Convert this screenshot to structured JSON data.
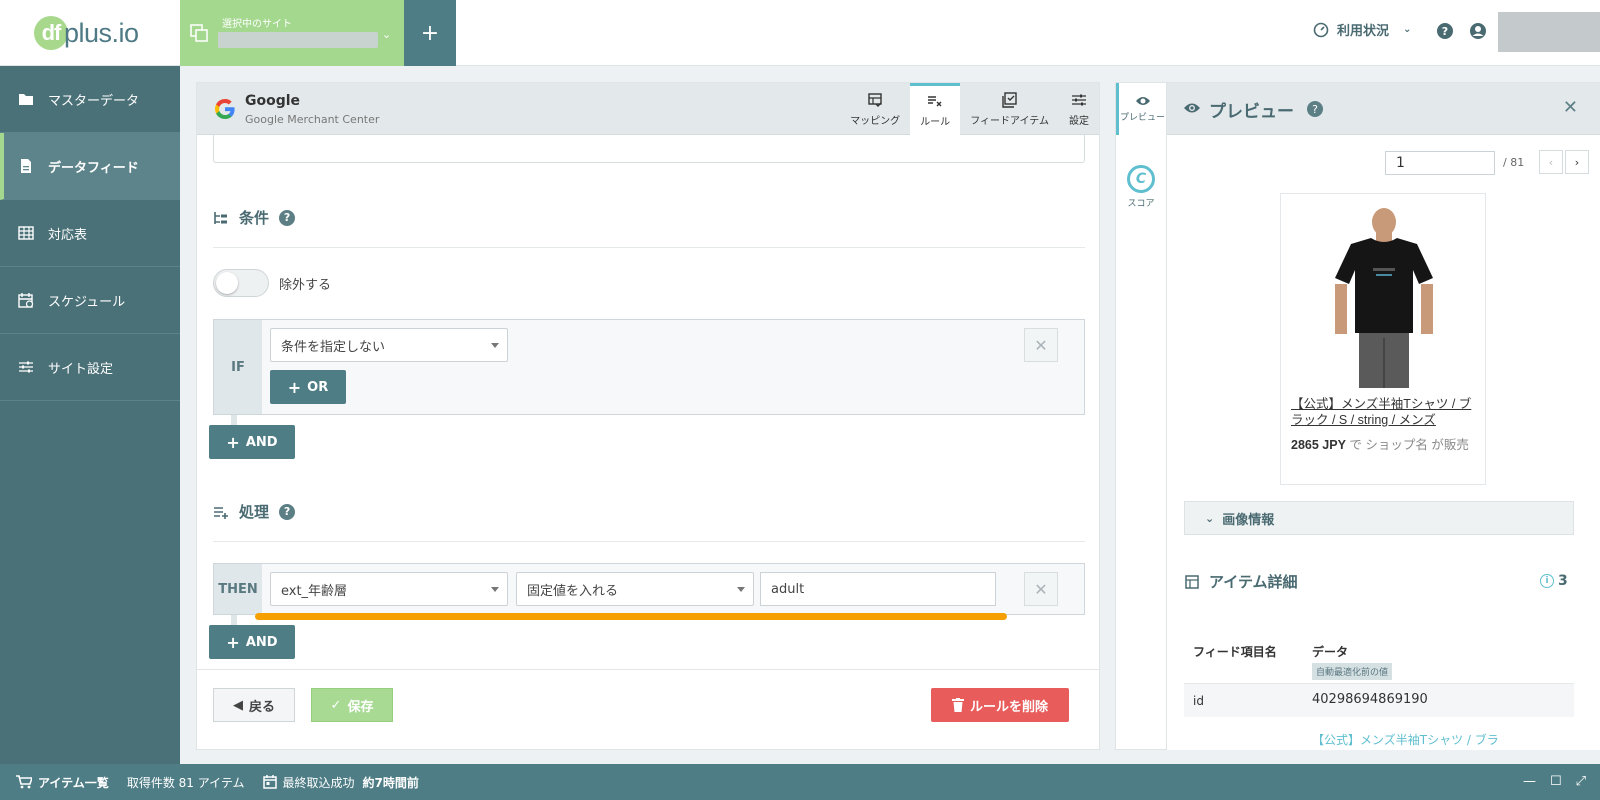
{
  "topbar": {
    "logo_text": "plus.io",
    "logo_mark": "df",
    "site_label": "選択中のサイト",
    "add_site": "+",
    "usage": "利用状況"
  },
  "sidebar": {
    "items": [
      {
        "label": "マスターデータ",
        "icon": "folder-icon"
      },
      {
        "label": "データフィード",
        "icon": "document-icon"
      },
      {
        "label": "対応表",
        "icon": "table-icon"
      },
      {
        "label": "スケジュール",
        "icon": "calendar-icon"
      },
      {
        "label": "サイト設定",
        "icon": "sliders-icon"
      }
    ]
  },
  "panel": {
    "channel_name": "Google",
    "channel_sub": "Google Merchant Center",
    "tabs": [
      {
        "label": "マッピング"
      },
      {
        "label": "ルール"
      },
      {
        "label": "フィードアイテム"
      },
      {
        "label": "設定"
      }
    ],
    "conditions_title": "条件",
    "exclude_label": "除外する",
    "if_label": "IF",
    "condition_select": "条件を指定しない",
    "or_button": "OR",
    "and_button": "AND",
    "process_title": "処理",
    "then_label": "THEN",
    "field_select": "ext_年齢層",
    "action_select": "固定値を入れる",
    "value_input": "adult",
    "back_button": "戻る",
    "save_button": "保存",
    "delete_button": "ルールを削除"
  },
  "rail": {
    "preview": "プレビュー",
    "score": "スコア",
    "score_letter": "C"
  },
  "preview": {
    "title": "プレビュー",
    "page_value": "1",
    "page_total": "/ 81",
    "product_title": "【公式】メンズ半袖Tシャツ / ブラック / S / string / メンズ",
    "price": "2865 JPY",
    "price_suffix": " で ショップ名 が販売",
    "image_info": "画像情報",
    "details_title": "アイテム詳細",
    "details_count": "3",
    "col_field": "フィード項目名",
    "col_data": "データ",
    "col_badge": "自動最適化前の値",
    "row_key": "id",
    "row_value": "40298694869190",
    "row2_value": "【公式】メンズ半袖Tシャツ / ブラ"
  },
  "status": {
    "items_label": "アイテム一覧",
    "count_text": "取得件数 81 アイテム",
    "last_import": "最終取込成功",
    "last_import_time": "約7時間前"
  },
  "colors": {
    "accent": "#4e7d85",
    "green": "#a5d88f",
    "highlight": "#f5a000",
    "danger": "#e85c5c",
    "teal": "#5fbfcf"
  }
}
